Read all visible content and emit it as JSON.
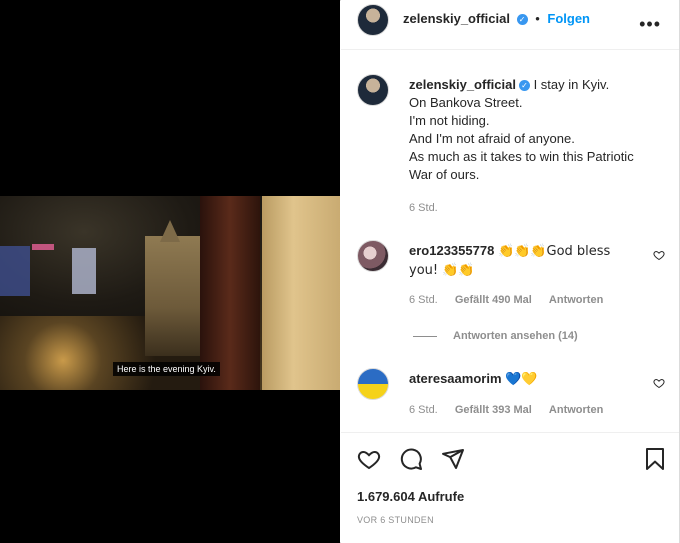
{
  "post": {
    "author": "zelenskiy_official",
    "follow_label": "Folgen",
    "separator": "•",
    "more_icon": "more-icon",
    "caption_lines": [
      "I stay in Kyiv.",
      "On Bankova Street.",
      "I'm not hiding.",
      "And I'm not afraid of anyone.",
      "As much as it takes to win this Patriotic",
      "War of ours."
    ],
    "caption_time": "6 Std."
  },
  "video": {
    "subtitle": "Here is the evening Kyiv."
  },
  "comments": [
    {
      "user": "ero123355778",
      "text_line1": "👏👏👏God bless",
      "text_line2": "you! 👏👏",
      "time": "6 Std.",
      "likes": "Gefällt 490 Mal",
      "reply": "Antworten",
      "view_replies": "Antworten ansehen (14)"
    },
    {
      "user": "ateresaamorim",
      "text": "💙💛",
      "time": "6 Std.",
      "likes": "Gefällt 393 Mal",
      "reply": "Antworten"
    }
  ],
  "stats": {
    "views": "1.679.604 Aufrufe",
    "ago": "VOR 6 STUNDEN"
  },
  "colors": {
    "accent": "#0095f6",
    "verified": "#3897f0",
    "muted": "#8e8e8e",
    "text": "#262626"
  }
}
